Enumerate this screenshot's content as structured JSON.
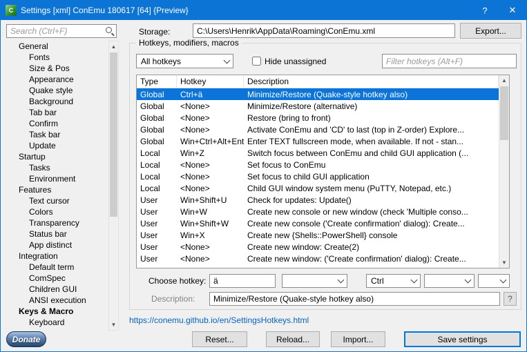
{
  "colors": {
    "titlebar": "#0b74d4",
    "selection": "#0a74da",
    "accent": "#0078d7"
  },
  "window": {
    "title": "Settings [xml] ConEmu 180617 [64] {Preview}",
    "help": "?",
    "close": "✕",
    "app_icon_glyph": "C"
  },
  "sidebar": {
    "search_placeholder": "Search (Ctrl+F)",
    "donate": "Donate",
    "tree": [
      {
        "label": "General",
        "level": 0
      },
      {
        "label": "Fonts",
        "level": 1
      },
      {
        "label": "Size & Pos",
        "level": 1
      },
      {
        "label": "Appearance",
        "level": 1
      },
      {
        "label": "Quake style",
        "level": 1
      },
      {
        "label": "Background",
        "level": 1
      },
      {
        "label": "Tab bar",
        "level": 1
      },
      {
        "label": "Confirm",
        "level": 1
      },
      {
        "label": "Task bar",
        "level": 1
      },
      {
        "label": "Update",
        "level": 1
      },
      {
        "label": "Startup",
        "level": 0
      },
      {
        "label": "Tasks",
        "level": 1
      },
      {
        "label": "Environment",
        "level": 1
      },
      {
        "label": "Features",
        "level": 0
      },
      {
        "label": "Text cursor",
        "level": 1
      },
      {
        "label": "Colors",
        "level": 1
      },
      {
        "label": "Transparency",
        "level": 1
      },
      {
        "label": "Status bar",
        "level": 1
      },
      {
        "label": "App distinct",
        "level": 1
      },
      {
        "label": "Integration",
        "level": 0
      },
      {
        "label": "Default term",
        "level": 1
      },
      {
        "label": "ComSpec",
        "level": 1
      },
      {
        "label": "Children GUI",
        "level": 1
      },
      {
        "label": "ANSI execution",
        "level": 1
      },
      {
        "label": "Keys & Macro",
        "level": 0,
        "selected": true
      },
      {
        "label": "Keyboard",
        "level": 1
      }
    ]
  },
  "storage": {
    "label": "Storage:",
    "value": "C:\\Users\\Henrik\\AppData\\Roaming\\ConEmu.xml",
    "export_label": "Export..."
  },
  "hotkeys": {
    "group_title": "Hotkeys, modifiers, macros",
    "scope_combo": "All hotkeys",
    "hide_unassigned": "Hide unassigned",
    "filter_placeholder": "Filter hotkeys (Alt+F)",
    "columns": [
      "Type",
      "Hotkey",
      "Description"
    ],
    "rows": [
      {
        "type": "Global",
        "hotkey": "Ctrl+ä",
        "description": "Minimize/Restore (Quake-style hotkey also)",
        "selected": true
      },
      {
        "type": "Global",
        "hotkey": "<None>",
        "description": "Minimize/Restore (alternative)"
      },
      {
        "type": "Global",
        "hotkey": "<None>",
        "description": "Restore (bring to front)"
      },
      {
        "type": "Global",
        "hotkey": "<None>",
        "description": "Activate ConEmu and 'CD' to last (top in Z-order) Explore..."
      },
      {
        "type": "Global",
        "hotkey": "Win+Ctrl+Alt+Enter",
        "description": "Enter TEXT fullscreen mode, when available. If not - stan..."
      },
      {
        "type": "Local",
        "hotkey": "Win+Z",
        "description": "Switch focus between ConEmu and child GUI application (..."
      },
      {
        "type": "Local",
        "hotkey": "<None>",
        "description": "Set focus to ConEmu"
      },
      {
        "type": "Local",
        "hotkey": "<None>",
        "description": "Set focus to child GUI application"
      },
      {
        "type": "Local",
        "hotkey": "<None>",
        "description": "Child GUI window system menu (PuTTY, Notepad, etc.)"
      },
      {
        "type": "User",
        "hotkey": "Win+Shift+U",
        "description": "Check for updates: Update()"
      },
      {
        "type": "User",
        "hotkey": "Win+W",
        "description": "Create new console or new window (check 'Multiple conso..."
      },
      {
        "type": "User",
        "hotkey": "Win+Shift+W",
        "description": "Create new console ('Create confirmation' dialog): Create..."
      },
      {
        "type": "User",
        "hotkey": "Win+X",
        "description": "Create new {Shells::PowerShell} console"
      },
      {
        "type": "User",
        "hotkey": "<None>",
        "description": "Create new window: Create(2)"
      },
      {
        "type": "User",
        "hotkey": "<None>",
        "description": "Create new window: ('Create confirmation' dialog): Create..."
      }
    ],
    "choose_label": "Choose hotkey:",
    "key_value": "ä",
    "key_combo": "",
    "mod1": "Ctrl",
    "mod2": "",
    "mod3": "",
    "description_label": "Description:",
    "description_value": "Minimize/Restore (Quake-style hotkey also)",
    "help_button": "?"
  },
  "link": {
    "text": "https://conemu.github.io/en/SettingsHotkeys.html"
  },
  "footer": {
    "reset": "Reset...",
    "reload": "Reload...",
    "import": "Import...",
    "save": "Save settings"
  }
}
